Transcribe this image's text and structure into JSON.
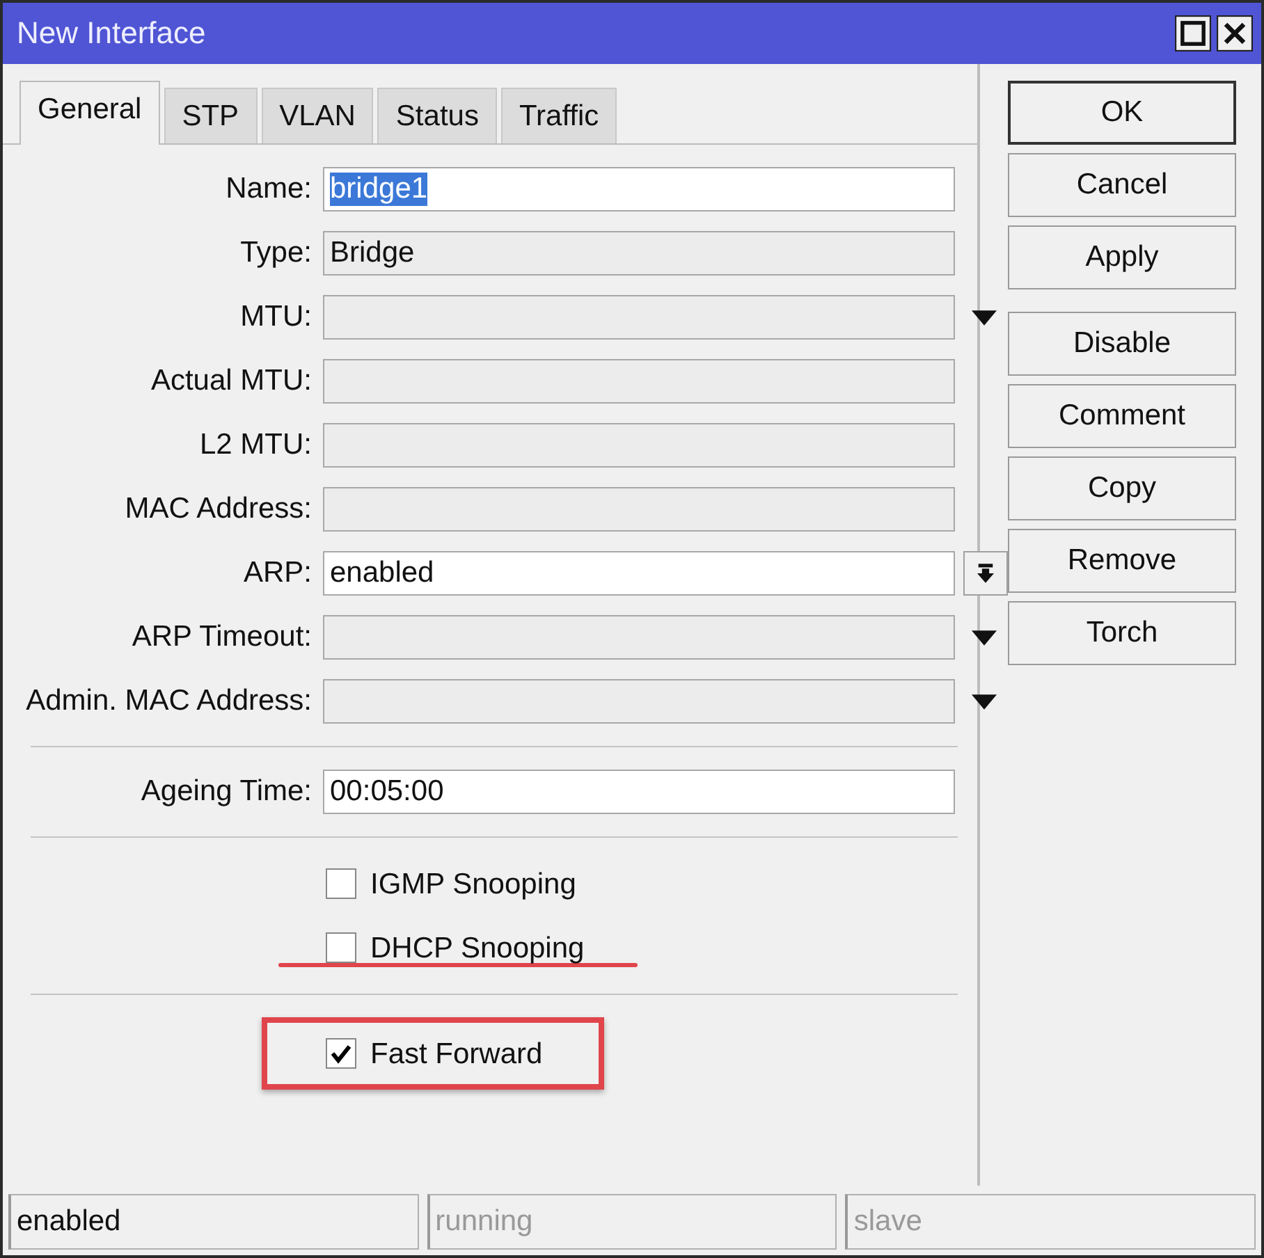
{
  "window": {
    "title": "New Interface"
  },
  "tabs": [
    {
      "label": "General",
      "selected": true
    },
    {
      "label": "STP",
      "selected": false
    },
    {
      "label": "VLAN",
      "selected": false
    },
    {
      "label": "Status",
      "selected": false
    },
    {
      "label": "Traffic",
      "selected": false
    }
  ],
  "sections": [
    {
      "kind": "fields",
      "items": [
        {
          "label": "Name:",
          "kind": "text",
          "value": "bridge1",
          "editable": true,
          "highlighted": true
        },
        {
          "label": "Type:",
          "kind": "text",
          "value": "Bridge",
          "editable": false,
          "highlighted": false
        },
        {
          "label": "MTU:",
          "kind": "dropdown",
          "editable": false
        },
        {
          "label": "Actual MTU:",
          "kind": "text",
          "editable": false
        },
        {
          "label": "L2 MTU:",
          "kind": "text",
          "editable": false
        },
        {
          "label": "MAC Address:",
          "kind": "text",
          "editable": false
        },
        {
          "label": "ARP:",
          "kind": "select",
          "value": "enabled",
          "editable": true,
          "highlighted": false
        },
        {
          "label": "ARP Timeout:",
          "kind": "dropdown",
          "editable": false
        },
        {
          "label": "Admin. MAC Address:",
          "kind": "dropdown",
          "editable": false
        }
      ]
    },
    {
      "kind": "fields",
      "items": [
        {
          "label": "Ageing Time:",
          "kind": "text",
          "value": "00:05:00",
          "editable": true,
          "highlighted": false
        }
      ]
    },
    {
      "kind": "checks",
      "items": [
        {
          "label": "IGMP Snooping",
          "checked": false,
          "struck": false,
          "highlighted": false
        },
        {
          "label": "DHCP Snooping",
          "checked": false,
          "struck": true,
          "highlighted": false
        }
      ]
    },
    {
      "kind": "checks",
      "items": [
        {
          "label": "Fast Forward",
          "checked": true,
          "struck": false,
          "highlighted": true
        }
      ]
    }
  ],
  "button_groups": [
    [
      {
        "label": "OK",
        "default": true
      },
      {
        "label": "Cancel",
        "default": false
      },
      {
        "label": "Apply",
        "default": false
      }
    ],
    [
      {
        "label": "Disable",
        "default": false
      },
      {
        "label": "Comment",
        "default": false
      },
      {
        "label": "Copy",
        "default": false
      },
      {
        "label": "Remove",
        "default": false
      },
      {
        "label": "Torch",
        "default": false
      }
    ]
  ],
  "status_bar": [
    {
      "text": "enabled",
      "disabled": false
    },
    {
      "text": "running",
      "disabled": true
    },
    {
      "text": "slave",
      "disabled": true
    }
  ]
}
